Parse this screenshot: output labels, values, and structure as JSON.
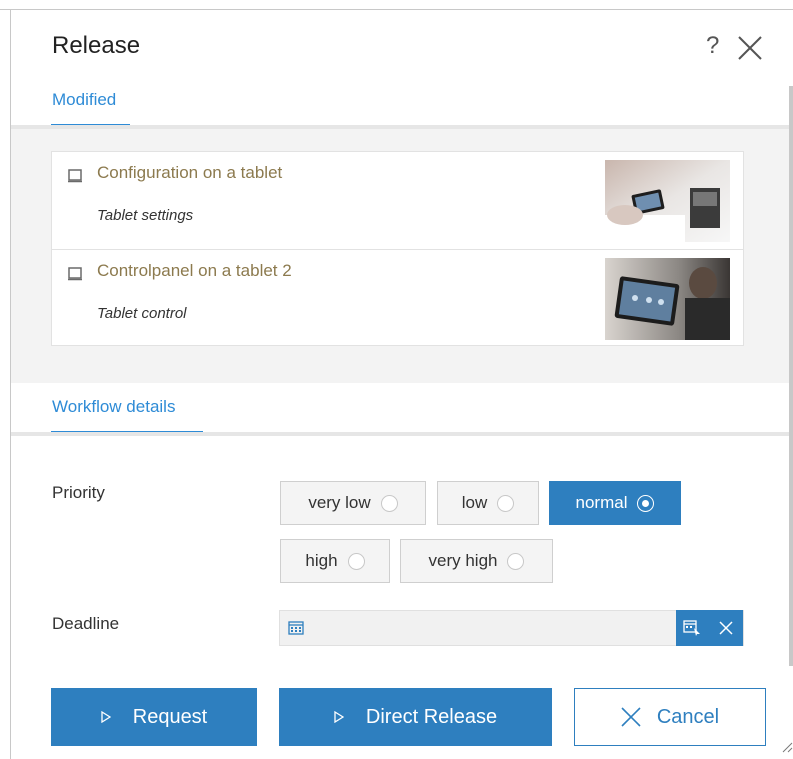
{
  "dialog": {
    "title": "Release",
    "help_glyph": "?",
    "close_icon": "close-icon"
  },
  "tabs": {
    "modified": "Modified",
    "workflow": "Workflow details"
  },
  "items": [
    {
      "title": "Configuration on a tablet",
      "subtitle": "Tablet settings",
      "icon": "page-icon",
      "thumbnail": "tablet-image"
    },
    {
      "title": "Controlpanel on a tablet 2",
      "subtitle": "Tablet control",
      "icon": "page-icon",
      "thumbnail": "tablet-image"
    }
  ],
  "priority": {
    "label": "Priority",
    "options": [
      "very low",
      "low",
      "normal",
      "high",
      "very high"
    ],
    "selected": "normal"
  },
  "deadline": {
    "label": "Deadline",
    "value": "",
    "placeholder": ""
  },
  "actions": {
    "request": "Request",
    "direct_release": "Direct Release",
    "cancel": "Cancel"
  },
  "colors": {
    "accent": "#2e7fbf",
    "tab": "#2e8bd6",
    "item_title": "#8c7a4e",
    "section_bg": "#f3f3f3"
  }
}
